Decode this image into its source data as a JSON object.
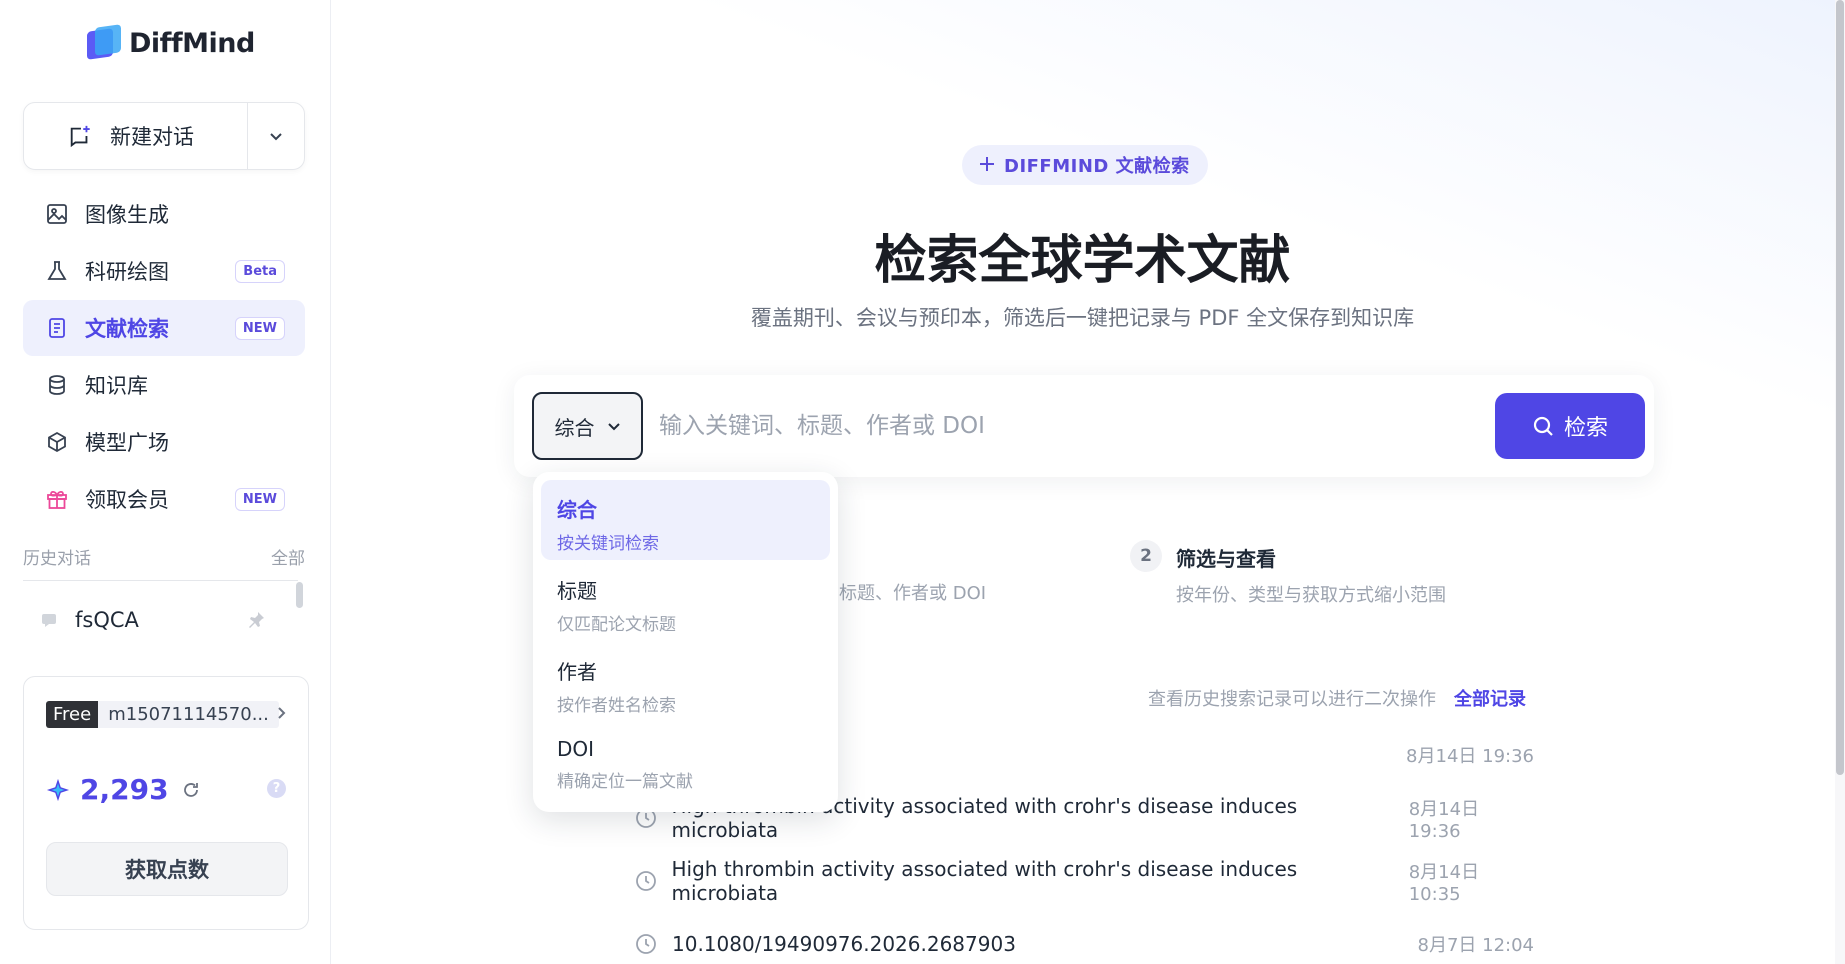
{
  "brand": {
    "name": "DiffMind"
  },
  "sidebar": {
    "new_chat": "新建对话",
    "items": [
      {
        "label": "图像生成",
        "badge": ""
      },
      {
        "label": "科研绘图",
        "badge": "Beta"
      },
      {
        "label": "文献检索",
        "badge": "NEW"
      },
      {
        "label": "知识库",
        "badge": ""
      },
      {
        "label": "模型广场",
        "badge": ""
      },
      {
        "label": "领取会员",
        "badge": "NEW"
      }
    ],
    "history_title": "历史对话",
    "history_all": "全部",
    "history_items": [
      "fsQCA"
    ]
  },
  "account": {
    "plan": "Free",
    "username": "m15071114570...",
    "points": "2,293",
    "get_points": "获取点数",
    "help": "?"
  },
  "main": {
    "pill": "DIFFMIND 文献检索",
    "title": "检索全球学术文献",
    "subtitle": "覆盖期刊、会议与预印本，筛选后一键把记录与 PDF 全文保存到知识库",
    "search": {
      "type": "综合",
      "placeholder": "输入关键词、标题、作者或 DOI",
      "button": "检索"
    },
    "step1_desc": "标题、作者或 DOI",
    "step2": {
      "num": "2",
      "title": "筛选与查看",
      "desc": "按年份、类型与获取方式缩小范围"
    },
    "history": {
      "tip": "查看历史搜索记录可以进行二次操作",
      "all": "全部记录",
      "records": [
        {
          "text": "",
          "time": "8月14日 19:36"
        },
        {
          "text": "High thrombin activity associated with crohr's disease induces microbiata",
          "time": "8月14日 19:36"
        },
        {
          "text": "High thrombin activity associated with crohr's disease induces microbiata",
          "time": "8月14日 10:35"
        },
        {
          "text": "10.1080/19490976.2026.2687903",
          "time": "8月7日 12:04"
        }
      ]
    }
  },
  "dropdown": {
    "options": [
      {
        "title": "综合",
        "desc": "按关键词检索"
      },
      {
        "title": "标题",
        "desc": "仅匹配论文标题"
      },
      {
        "title": "作者",
        "desc": "按作者姓名检索"
      },
      {
        "title": "DOI",
        "desc": "精确定位一篇文献"
      }
    ]
  },
  "colors": {
    "accent": "#4f46e5",
    "accent_light": "#eef0fd"
  }
}
